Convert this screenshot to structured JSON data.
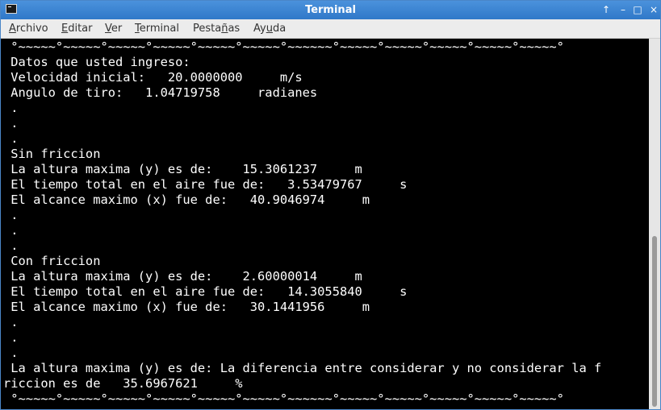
{
  "window": {
    "title": "Terminal",
    "buttons": {
      "shade": "↑",
      "minimize": "–",
      "maximize": "□",
      "close": "×"
    }
  },
  "menu": [
    {
      "pre": "",
      "mn": "A",
      "post": "rchivo"
    },
    {
      "pre": "",
      "mn": "E",
      "post": "ditar"
    },
    {
      "pre": "",
      "mn": "V",
      "post": "er"
    },
    {
      "pre": "",
      "mn": "T",
      "post": "erminal"
    },
    {
      "pre": "Pesta",
      "mn": "ñ",
      "post": "as"
    },
    {
      "pre": "Ay",
      "mn": "u",
      "post": "da"
    }
  ],
  "terminal": {
    "lines": [
      " °~~~~~°~~~~~°~~~~~°~~~~~°~~~~~°~~~~~°~~~~~~°~~~~~°~~~~~°~~~~~°~~~~~°~~~~~°",
      " Datos que usted ingreso:",
      " Velocidad inicial:   20.0000000     m/s",
      " Angulo de tiro:   1.04719758     radianes",
      " .",
      " .",
      " .",
      " Sin friccion",
      " La altura maxima (y) es de:    15.3061237     m",
      " El tiempo total en el aire fue de:   3.53479767     s",
      " El alcance maximo (x) fue de:   40.9046974     m",
      " .",
      " .",
      " .",
      " Con friccion",
      " La altura maxima (y) es de:    2.60000014     m",
      " El tiempo total en el aire fue de:   14.3055840     s",
      " El alcance maximo (x) fue de:   30.1441956     m",
      " .",
      " .",
      " .",
      " La altura maxima (y) es de: La diferencia entre considerar y no considerar la f",
      "riccion es de   35.6967621     %",
      " °~~~~~°~~~~~°~~~~~°~~~~~°~~~~~°~~~~~°~~~~~~°~~~~~°~~~~~°~~~~~°~~~~~°~~~~~°"
    ]
  },
  "scrollbar": {
    "position_fraction": 0.56,
    "visible_fraction": 0.46
  }
}
